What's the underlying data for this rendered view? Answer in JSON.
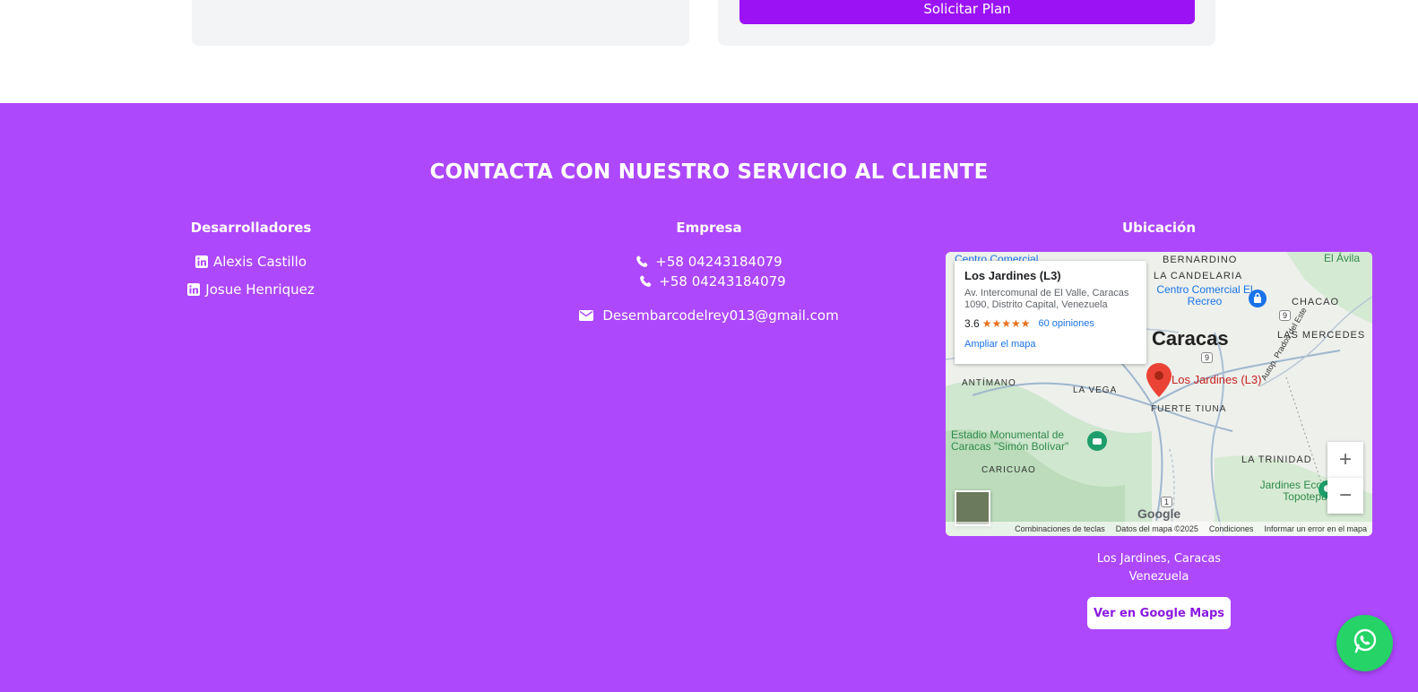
{
  "top": {
    "plan_button": "Solicitar Plan"
  },
  "footer": {
    "title": "CONTACTA CON NUESTRO SERVICIO AL CLIENTE",
    "developers": {
      "heading": "Desarrolladores",
      "items": [
        {
          "icon": "linkedin-icon",
          "name": "Alexis Castillo"
        },
        {
          "icon": "linkedin-icon",
          "name": "Josue Henriquez"
        }
      ]
    },
    "company": {
      "heading": "Empresa",
      "phones": [
        "+58 04243184079",
        "+58 04243184079"
      ],
      "email": "Desembarcodelrey013@gmail.com"
    },
    "location": {
      "heading": "Ubicación",
      "address_line1": "Los Jardines, Caracas",
      "address_line2": "Venezuela",
      "maps_button": "Ver en Google Maps"
    }
  },
  "map": {
    "place_card": {
      "name": "Los Jardines (L3)",
      "address": "Av. Intercomunal de El Valle, Caracas 1090, Distrito Capital, Venezuela",
      "rating": "3.6",
      "stars": "★★★★★",
      "reviews": "60 opiniones",
      "expand_link": "Ampliar el mapa"
    },
    "marker_label": "Los Jardines (L3)",
    "labels": {
      "caracas": "Caracas",
      "bernardino": "BERNARDINO",
      "candelaria": "LA CANDELARIA",
      "chacao": "CHACAO",
      "mercedes": "LAS MERCEDES",
      "avila": "El Ávila",
      "recreo": "Centro Comercial El Recreo",
      "cc_top": "Centro Comercial",
      "antimano": "ANTÍMANO",
      "vega": "LA VEGA",
      "tiuna": "FUERTE TIUNA",
      "estadio": "Estadio Monumental de Caracas \"Simón Bolívar\"",
      "caricuao": "CARICUAO",
      "trinidad": "LA TRINIDAD",
      "jardines_eco": "Jardines Ecológicos Topotepuy",
      "autop": "Autop. Prados del Este",
      "r9a": "9",
      "r9b": "9",
      "r1": "1",
      "google": "Google"
    },
    "zoom_in": "+",
    "zoom_out": "−",
    "footer_links": [
      "Combinaciones de teclas",
      "Datos del mapa ©2025",
      "Condiciones",
      "Informar un error en el mapa"
    ]
  },
  "colors": {
    "footer_bg": "#ad48fc",
    "plan_button": "#9b12f5",
    "whatsapp": "#25d366",
    "gmaps_text": "#8b19e0"
  }
}
